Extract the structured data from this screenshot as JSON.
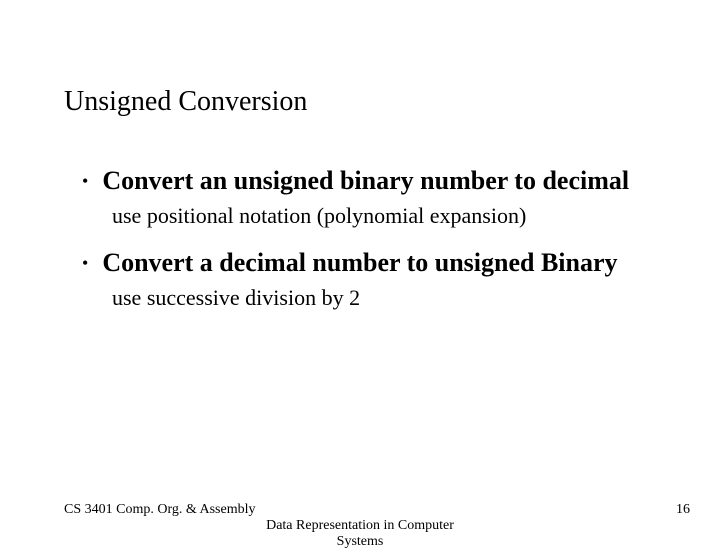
{
  "title": "Unsigned Conversion",
  "bullets": [
    {
      "heading": "Convert an unsigned binary number to decimal",
      "sub": "use positional notation (polynomial expansion)"
    },
    {
      "heading": "Convert a decimal number to unsigned Binary",
      "sub": "use successive division by 2"
    }
  ],
  "footer": {
    "left": "CS 3401 Comp. Org. & Assembly",
    "center": "Data Representation in Computer Systems",
    "right": "16"
  }
}
